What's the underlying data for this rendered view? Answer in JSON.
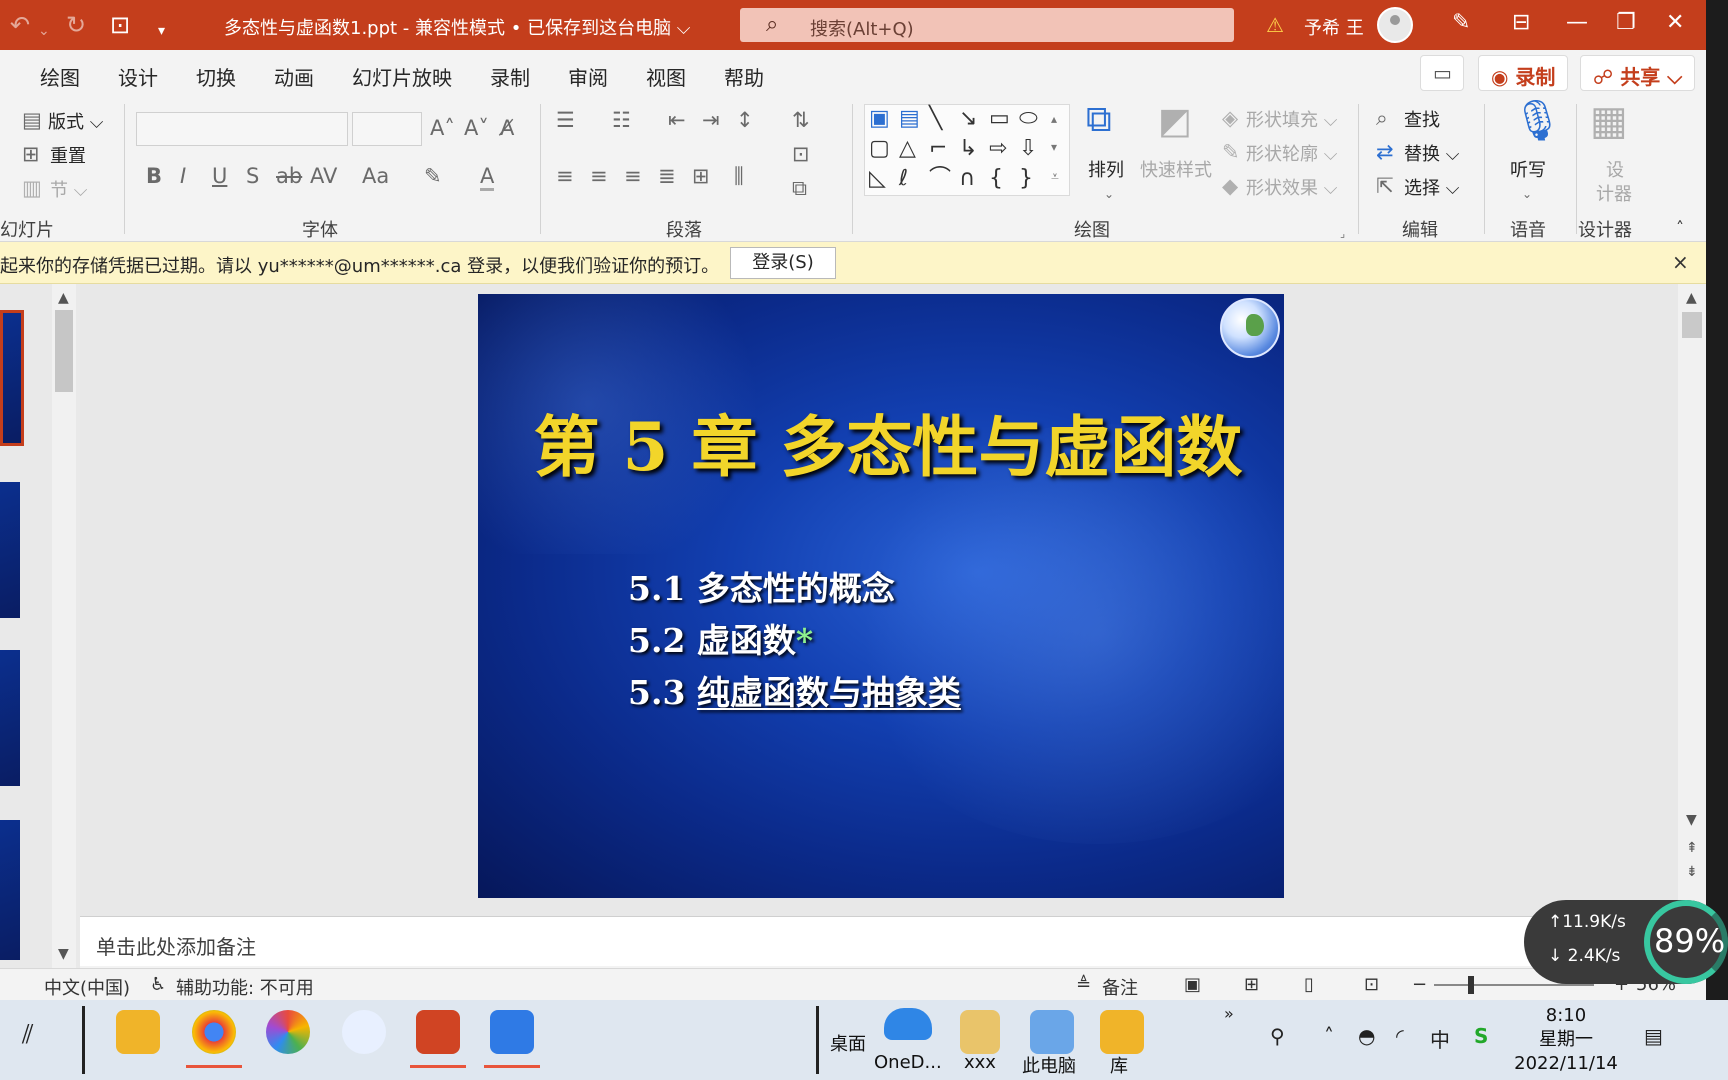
{
  "titlebar": {
    "doc_title": "多态性与虚函数1.ppt  -  兼容性模式 • 已保存到这台电脑 ⌵",
    "search_placeholder": "搜索(Alt+Q)",
    "user_name": "予希 王",
    "accent_color": "#c43e1c"
  },
  "tabs": {
    "items": [
      "绘图",
      "设计",
      "切换",
      "动画",
      "幻灯片放映",
      "录制",
      "审阅",
      "视图",
      "帮助"
    ],
    "record_button": "◉ 录制",
    "share_button": "☍ 共享 ⌵"
  },
  "ribbon": {
    "slides_group": {
      "layout": "版式 ⌵",
      "reset": "重置",
      "section": "节 ⌵",
      "label": "幻灯片"
    },
    "font_group": {
      "label": "字体"
    },
    "paragraph_group": {
      "label": "段落"
    },
    "drawing_group": {
      "arrange": "排列",
      "quick_styles": "快速样式",
      "shape_fill": "形状填充 ⌵",
      "shape_outline": "形状轮廓 ⌵",
      "shape_effects": "形状效果 ⌵",
      "label": "绘图"
    },
    "editing_group": {
      "find": "查找",
      "replace": "替换 ⌵",
      "select": "选择 ⌵",
      "label": "编辑"
    },
    "voice_group": {
      "dictate": "听写",
      "label": "语音"
    },
    "designer_group": {
      "designer_line1": "设",
      "designer_line2": "计器",
      "label": "设计器"
    }
  },
  "notification": {
    "message": "起来你的存储凭据已过期。请以 yu******@um******.ca 登录，以便我们验证你的预订。",
    "login_button": "登录(S)"
  },
  "slide": {
    "title": "第 5 章  多态性与虚函数",
    "items": [
      {
        "text": "5.1 多态性的概念",
        "star": ""
      },
      {
        "text": "5.2 虚函数",
        "star": "*"
      },
      {
        "text": "纯虚函数与抽象类",
        "prefix": "5.3 "
      }
    ]
  },
  "notes": {
    "placeholder": "单击此处添加备注"
  },
  "statusbar": {
    "language": "中文(中国)",
    "accessibility": "辅助功能: 不可用",
    "notes_button": "备注",
    "zoom": "56%"
  },
  "network": {
    "up": "↑11.9K/s",
    "down": "↓ 2.4K/s",
    "percent": "89%"
  },
  "taskbar": {
    "labels": {
      "desktop": "桌面",
      "onedrive": "OneD...",
      "xxx": "xxx",
      "this_pc": "此电脑",
      "library": "库"
    },
    "ime": "中",
    "time": "8:10",
    "weekday": "星期一",
    "date": "2022/11/14"
  }
}
